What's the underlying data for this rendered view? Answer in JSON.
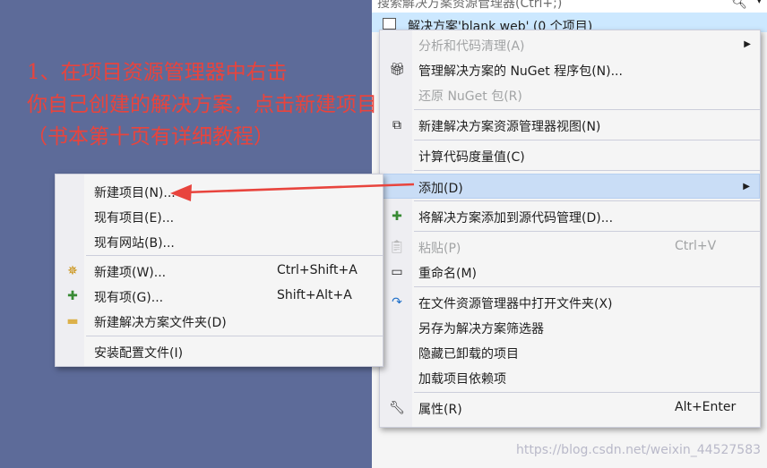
{
  "search": {
    "text": "搜索解决方案资源管理器(Ctrl+;)"
  },
  "solution_row": {
    "label": "解决方案'blank web' (0 个项目)"
  },
  "context_menu": {
    "items": [
      {
        "label": "分析和代码清理(A)",
        "disabled": true,
        "submenu": true
      },
      {
        "label": "管理解决方案的 NuGet 程序包(N)...",
        "icon": "nuget-icon"
      },
      {
        "label": "还原 NuGet 包(R)",
        "disabled": true
      },
      {
        "label": "新建解决方案资源管理器视图(N)",
        "icon": "new-view-icon"
      },
      {
        "label": "计算代码度量值(C)"
      },
      {
        "label": "添加(D)",
        "submenu": true,
        "active": true
      },
      {
        "label": "将解决方案添加到源代码管理(D)...",
        "icon": "source-control-icon"
      },
      {
        "label": "粘贴(P)",
        "shortcut": "Ctrl+V",
        "disabled": true,
        "icon": "paste-icon"
      },
      {
        "label": "重命名(M)",
        "icon": "rename-icon"
      },
      {
        "label": "在文件资源管理器中打开文件夹(X)",
        "icon": "refresh-arrow-icon"
      },
      {
        "label": "另存为解决方案筛选器"
      },
      {
        "label": "隐藏已卸载的项目"
      },
      {
        "label": "加载项目依赖项"
      },
      {
        "label": "属性(R)",
        "shortcut": "Alt+Enter",
        "icon": "wrench-icon"
      }
    ]
  },
  "add_submenu": {
    "items": [
      {
        "label": "新建项目(N)..."
      },
      {
        "label": "现有项目(E)..."
      },
      {
        "label": "现有网站(B)..."
      },
      {
        "label": "新建项(W)...",
        "shortcut": "Ctrl+Shift+A",
        "icon": "new-item-icon"
      },
      {
        "label": "现有项(G)...",
        "shortcut": "Shift+Alt+A",
        "icon": "existing-item-icon"
      },
      {
        "label": "新建解决方案文件夹(D)",
        "icon": "new-folder-icon"
      },
      {
        "label": "安装配置文件(I)"
      }
    ]
  },
  "annotation": {
    "line1": "1、在项目资源管理器中右击",
    "line2": "你自己创建的解决方案，点击新建项目",
    "line3": "（书本第十页有详细教程）"
  },
  "watermark": "https://blog.csdn.net/weixin_44527583",
  "colors": {
    "background": "#5d6b99",
    "menu": "#f5f5f5",
    "highlight": "#c9ddf6",
    "annotation": "#e8443d"
  }
}
